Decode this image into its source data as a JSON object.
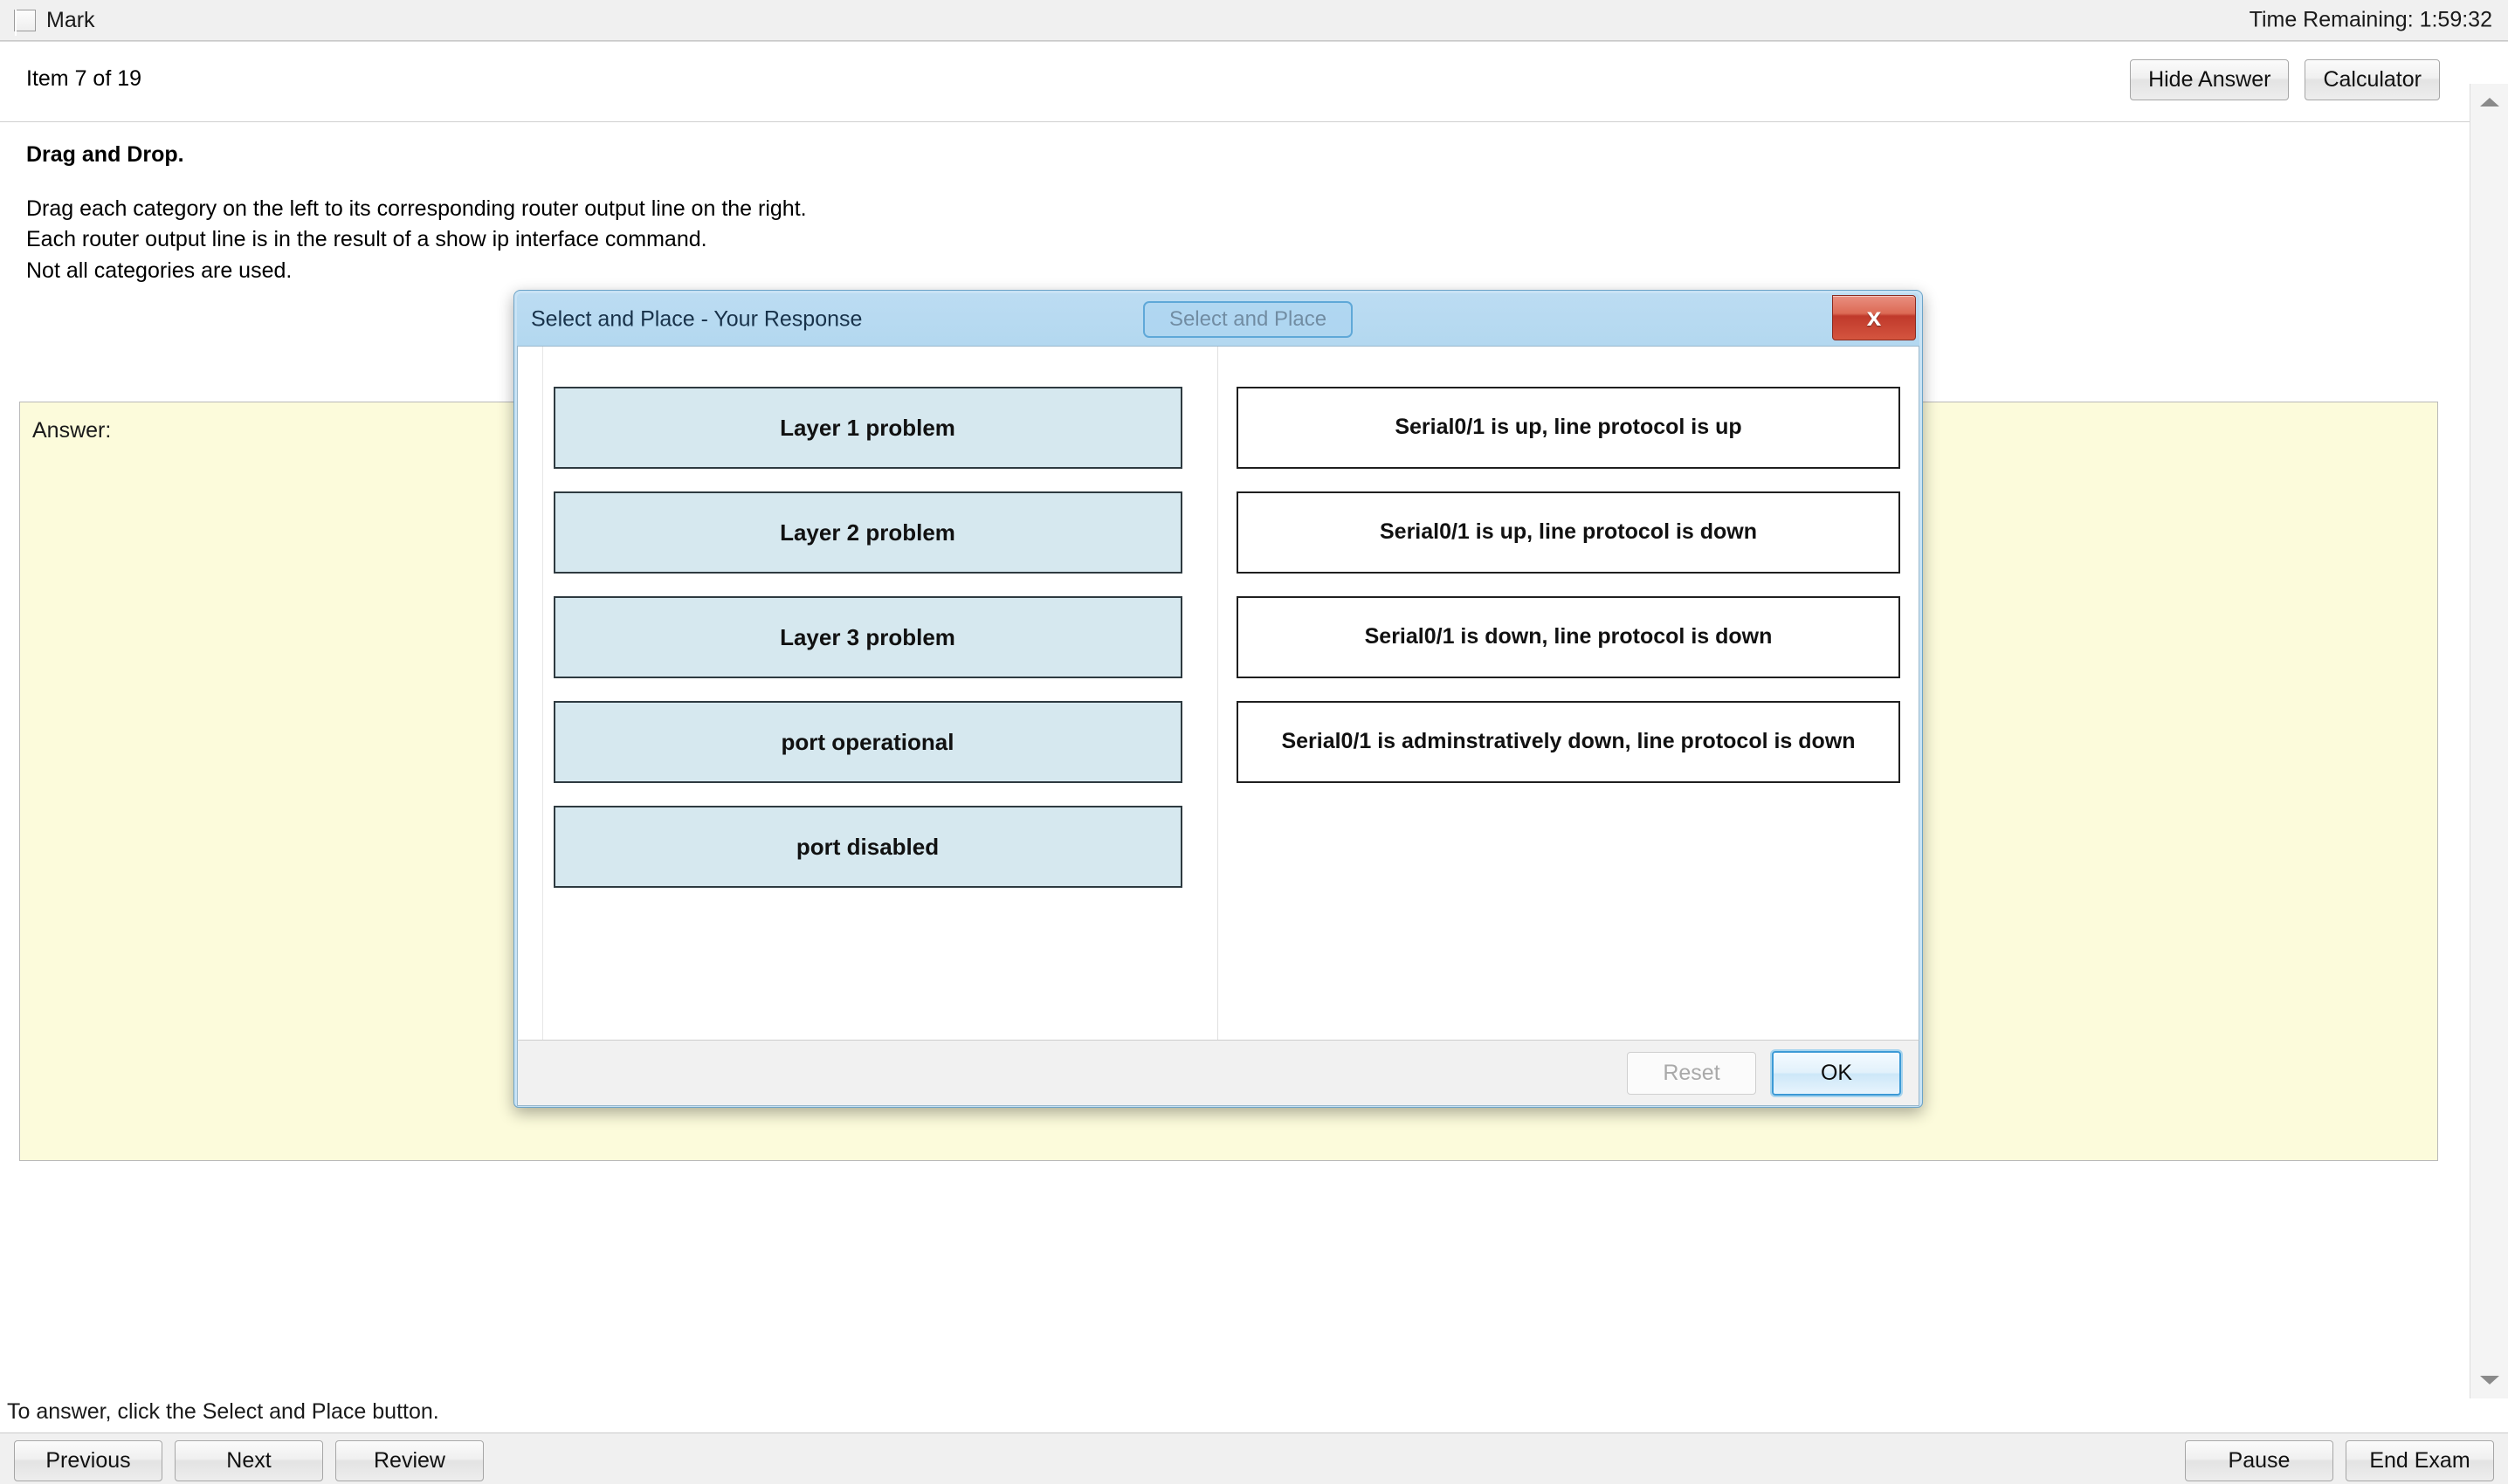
{
  "topbar": {
    "mark_label": "Mark",
    "time_remaining": "Time Remaining: 1:59:32"
  },
  "item_header": {
    "item_counter": "Item 7 of 19",
    "hide_answer_label": "Hide Answer",
    "calculator_label": "Calculator"
  },
  "instructions": {
    "heading": "Drag and Drop.",
    "line1": "Drag each category on the left to its corresponding router output line on the right.",
    "line2": "Each router output line is in the result of a show ip interface command.",
    "line3": "Not all categories are used."
  },
  "answer_panel": {
    "label": "Answer:"
  },
  "dialog": {
    "title": "Select and Place - Your Response",
    "ghost_button_label": "Select and Place",
    "close_label": "x",
    "categories": [
      {
        "label": "Layer 1 problem"
      },
      {
        "label": "Layer 2 problem"
      },
      {
        "label": "Layer 3 problem"
      },
      {
        "label": "port operational"
      },
      {
        "label": "port disabled"
      }
    ],
    "targets": [
      {
        "label": "Serial0/1 is up, line protocol is up"
      },
      {
        "label": "Serial0/1 is up, line protocol is down"
      },
      {
        "label": "Serial0/1 is down, line protocol is down"
      },
      {
        "label": "Serial0/1 is adminstratively down, line protocol is down"
      }
    ],
    "reset_label": "Reset",
    "ok_label": "OK"
  },
  "footer": {
    "status_text": "To answer, click the Select and Place button.",
    "previous_label": "Previous",
    "next_label": "Next",
    "review_label": "Review",
    "pause_label": "Pause",
    "end_exam_label": "End Exam"
  },
  "colors": {
    "tile_fill": "#d6e8ef",
    "answer_panel": "#fcfbdb",
    "dialog_titlebar": "#b3d8f0",
    "close_button": "#c0392b"
  }
}
